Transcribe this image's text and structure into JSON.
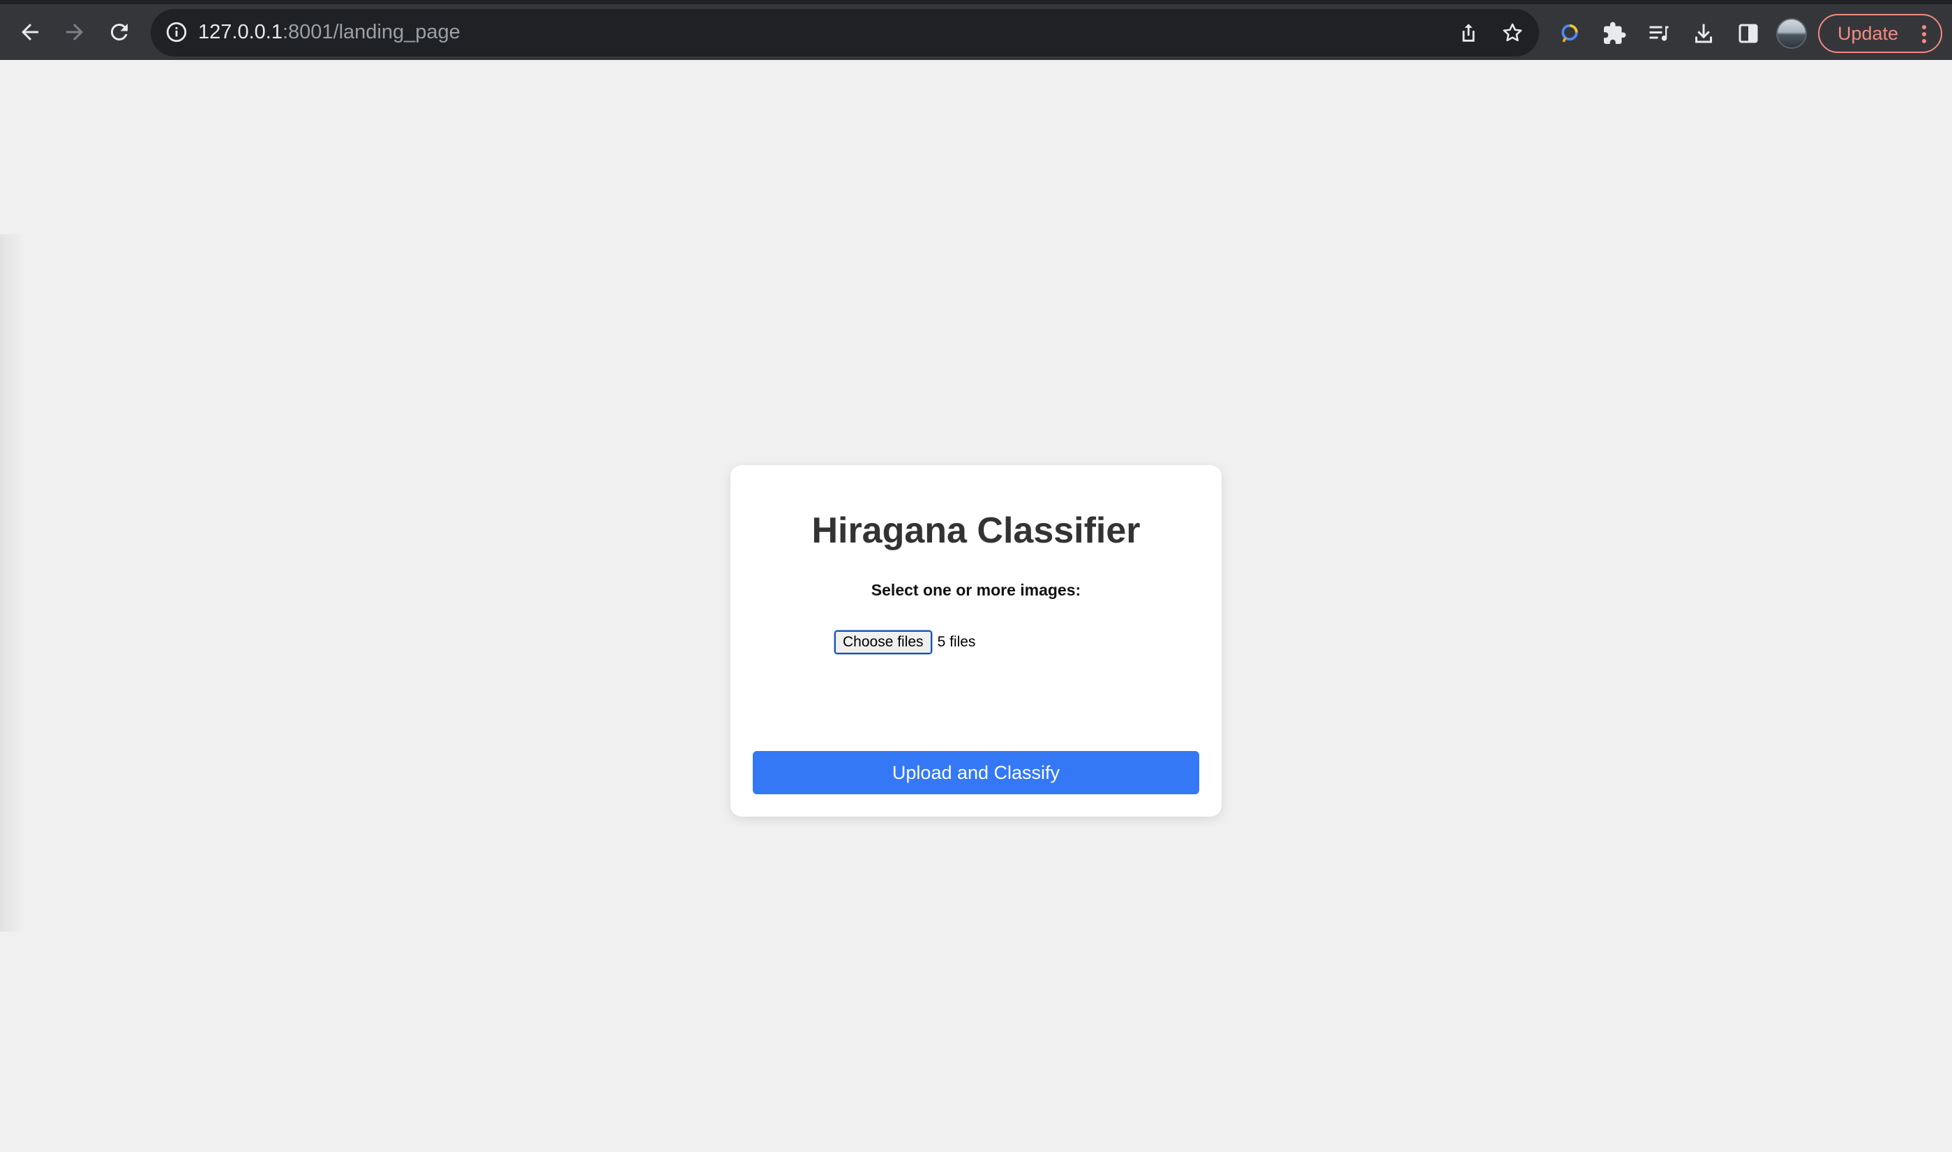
{
  "browser": {
    "url_host": "127.0.0.1",
    "url_rest": ":8001/landing_page",
    "update_label": "Update",
    "icons": {
      "back": "arrow-left-icon",
      "forward": "arrow-right-icon",
      "reload": "reload-icon",
      "site_info": "info-icon",
      "share": "share-icon",
      "bookmark": "star-icon",
      "extension_1": "colorful-extension-icon",
      "extensions": "puzzle-icon",
      "reading_list": "reading-list-icon",
      "downloads": "download-icon",
      "side_panel": "side-panel-icon",
      "profile": "avatar",
      "menu": "kebab-menu-icon"
    }
  },
  "page": {
    "title": "Hiragana Classifier",
    "file_label": "Select one or more images:",
    "choose_files_label": "Choose files",
    "file_count": "5 files",
    "submit_label": "Upload and Classify"
  },
  "colors": {
    "page_background": "#f0f0f0",
    "card_background": "#ffffff",
    "primary_button": "#3478f6",
    "title_text": "#333333",
    "update_accent": "#f28b82"
  }
}
